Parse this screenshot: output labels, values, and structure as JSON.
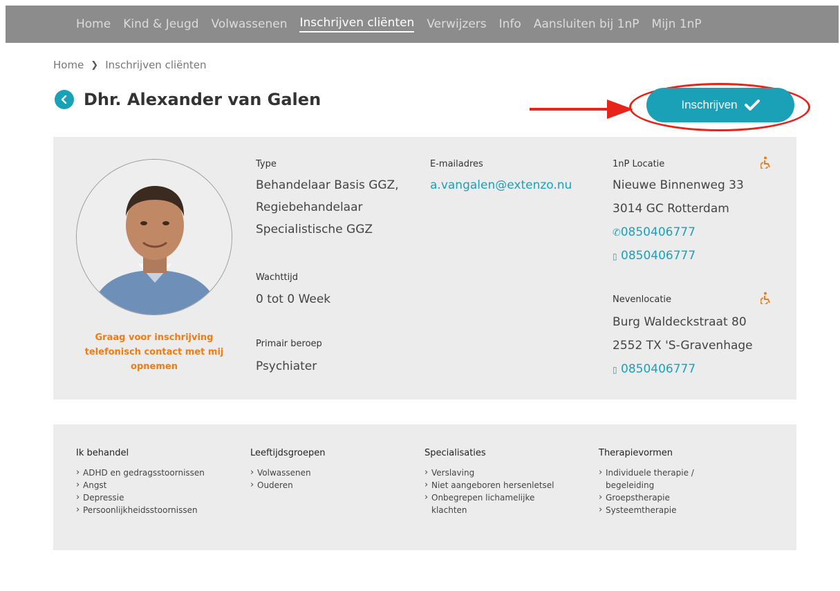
{
  "nav": {
    "items": [
      "Home",
      "Kind & Jeugd",
      "Volwassenen",
      "Inschrijven cliënten",
      "Verwijzers",
      "Info",
      "Aansluiten bij 1nP",
      "Mijn 1nP"
    ],
    "active_index": 3
  },
  "breadcrumb": {
    "home": "Home",
    "current": "Inschrijven cliënten"
  },
  "profile": {
    "name": "Dhr. Alexander van Galen",
    "cta_label": "Inschrijven",
    "contact_note": "Graag voor inschrijving telefonisch contact met mij opnemen",
    "type_label": "Type",
    "type_lines": [
      "Behandelaar Basis GGZ,",
      "Regiebehandelaar",
      "Specialistische GGZ"
    ],
    "wait_label": "Wachttijd",
    "wait_value": "0 tot 0 Week",
    "profession_label": "Primair beroep",
    "profession_value": "Psychiater",
    "email_label": "E-mailadres",
    "email_value": "a.vangalen@extenzo.nu",
    "main_location": {
      "label": "1nP Locatie",
      "street": "Nieuwe Binnenweg 33",
      "city": "3014 GC Rotterdam",
      "phone": "0850406777",
      "mobile": "0850406777"
    },
    "side_location": {
      "label": "Nevenlocatie",
      "street": "Burg Waldeckstraat 80",
      "city": "2552 TX 'S-Gravenhage",
      "mobile": "0850406777"
    }
  },
  "details": {
    "treats": {
      "title": "Ik behandel",
      "items": [
        "ADHD en gedragsstoornissen",
        "Angst",
        "Depressie",
        "Persoonlijkheidsstoornissen"
      ]
    },
    "ages": {
      "title": "Leeftijdsgroepen",
      "items": [
        "Volwassenen",
        "Ouderen"
      ]
    },
    "specializations": {
      "title": "Specialisaties",
      "items": [
        "Verslaving",
        "Niet aangeboren hersenletsel",
        "Onbegrepen lichamelijke",
        "klachten"
      ]
    },
    "therapies": {
      "title": "Therapievormen",
      "items": [
        "Individuele therapie /",
        "begeleiding",
        "Groepstherapie",
        "Systeemtherapie"
      ]
    }
  },
  "colors": {
    "accent": "#1aa1b8",
    "highlight": "#e8231a",
    "note": "#f07c12",
    "nav_bg": "#8c8c8c",
    "card_bg": "#ececec"
  }
}
